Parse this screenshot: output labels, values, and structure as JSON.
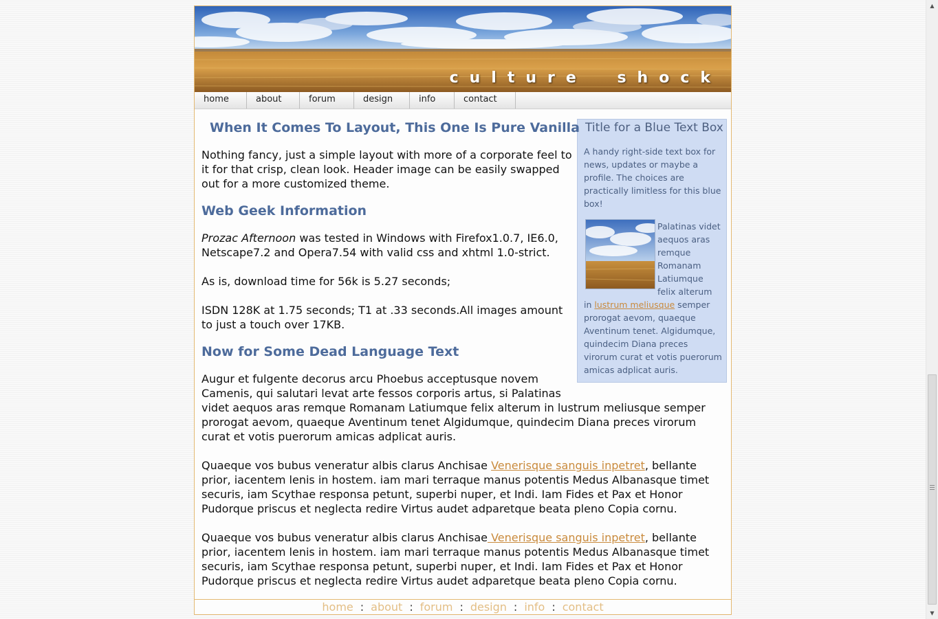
{
  "header": {
    "site_title": "culture shock"
  },
  "nav": {
    "items": [
      {
        "label": "home"
      },
      {
        "label": "about"
      },
      {
        "label": "forum"
      },
      {
        "label": "design"
      },
      {
        "label": "info"
      },
      {
        "label": "contact"
      }
    ]
  },
  "main": {
    "heading": "When It Comes To Layout, This One Is Pure Vanilla",
    "intro": "Nothing fancy, just a simple layout with more of a corporate feel to it for that crisp, clean look. Header image can be easily swapped out for a more customized theme.",
    "section_web_geek": {
      "heading": "Web Geek Information",
      "p1_italic": "Prozac Afternoon",
      "p1_rest": " was tested in Windows with Firefox1.0.7, IE6.0, Netscape7.2 and Opera7.54 with valid css and xhtml 1.0-strict.",
      "p2": "As is, download time for 56k is 5.27 seconds;",
      "p3": "ISDN 128K at 1.75 seconds; T1 at .33 seconds.All images amount to just a touch over 17KB."
    },
    "section_dead_language": {
      "heading": "Now for Some Dead Language Text",
      "p1": "Augur et fulgente decorus arcu Phoebus acceptusque novem Camenis, qui salutari levat arte fessos corporis artus, si Palatinas videt aequos aras remque Romanam Latiumque felix alterum in lustrum meliusque semper prorogat aevom, quaeque Aventinum tenet Algidumque, quindecim Diana preces virorum curat et votis puerorum amicas adplicat auris.",
      "p2_before": "Quaeque vos bubus veneratur albis clarus Anchisae ",
      "p2_link": "Venerisque sanguis inpetret",
      "p2_after": ", bellante prior, iacentem lenis in hostem. iam mari terraque manus potentis Medus Albanasque timet securis, iam Scythae responsa petunt, superbi nuper, et Indi. Iam Fides et Pax et Honor Pudorque priscus et neglecta redire Virtus audet adparetque beata pleno Copia cornu.",
      "p3_before": "Quaeque vos bubus veneratur albis clarus Anchisae",
      "p3_link": " Venerisque sanguis inpetret",
      "p3_after": ", bellante prior, iacentem lenis in hostem. iam mari terraque manus potentis Medus Albanasque timet securis, iam Scythae responsa petunt, superbi nuper, et Indi. Iam Fides et Pax et Honor Pudorque priscus et neglecta redire Virtus audet adparetque beata pleno Copia cornu."
    }
  },
  "sidebar": {
    "title": "Title for a Blue Text Box",
    "intro": "A handy right-side text box for news, updates or maybe a profile. The choices are practically limitless for this blue box!",
    "text_before": "Palatinas videt aequos aras remque Romanam Latiumque felix alterum in ",
    "link": "lustrum meliusque",
    "text_after": " semper prorogat aevom, quaeque Aventinum tenet. Algidumque, quindecim Diana preces virorum curat et votis puerorum amicas adplicat auris."
  },
  "footer": {
    "links": [
      "home",
      "about",
      "forum",
      "design",
      "info",
      "contact"
    ],
    "separator": ":"
  },
  "colors": {
    "heading": "#4d6b9b",
    "link": "#c98a3c",
    "sidebar_bg": "#cfdcf3",
    "border": "#e3b871"
  },
  "icons": {
    "scroll_up": "arrow-up-icon",
    "scroll_down": "arrow-down-icon"
  }
}
